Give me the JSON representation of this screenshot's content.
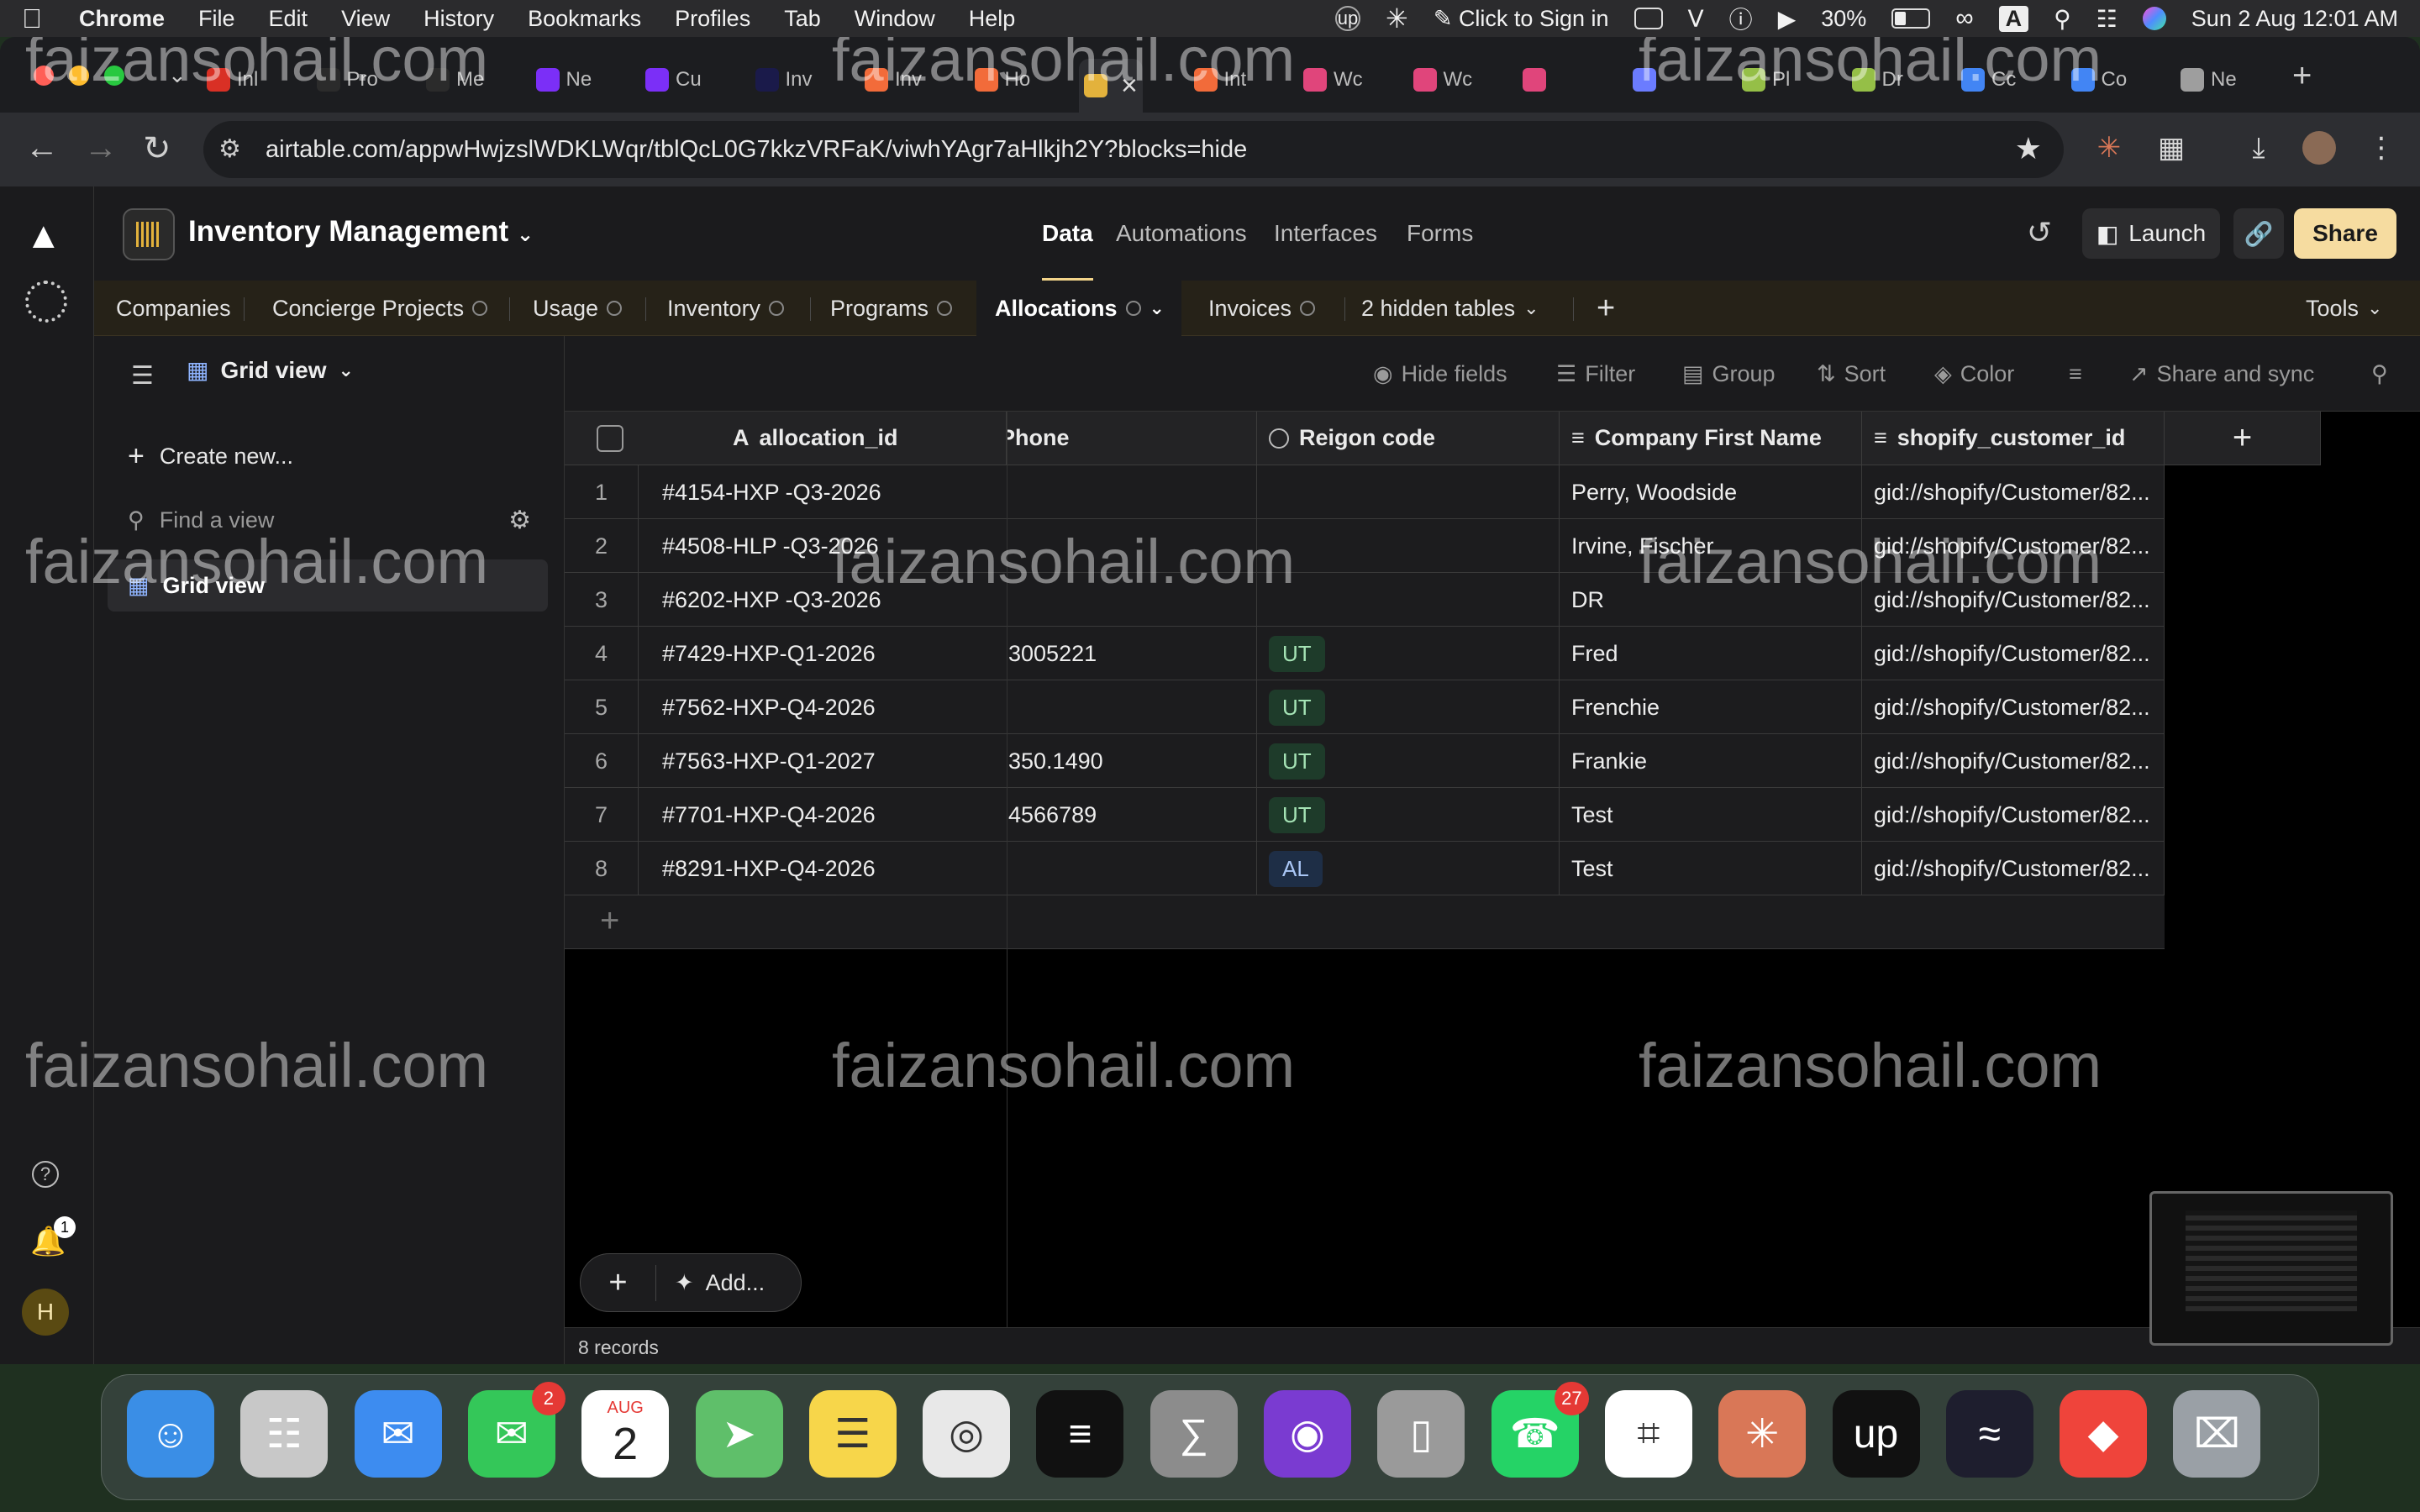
{
  "menubar": {
    "app": "Chrome",
    "items": [
      "File",
      "Edit",
      "View",
      "History",
      "Bookmarks",
      "Profiles",
      "Tab",
      "Window",
      "Help"
    ],
    "sign_in": "Click to Sign in",
    "battery": "30%",
    "battery_level": 0.3,
    "input_source": "A",
    "datetime": "Sun 2 Aug  12:01 AM"
  },
  "browser": {
    "tabs": [
      {
        "label": "Inl",
        "color": "#d93025"
      },
      {
        "label": "Pro",
        "color": "#2b2b2b"
      },
      {
        "label": "Me",
        "color": "#2b2b2b"
      },
      {
        "label": "Ne",
        "color": "#7b2ff7"
      },
      {
        "label": "Cu",
        "color": "#7b2ff7"
      },
      {
        "label": "Inv",
        "color": "#1a1a4a"
      },
      {
        "label": "Inv",
        "color": "#f26b3a"
      },
      {
        "label": "Ho",
        "color": "#f26b3a"
      },
      {
        "label": "",
        "color": "#e3b23c"
      },
      {
        "label": "Int",
        "color": "#f26b3a"
      },
      {
        "label": "Wc",
        "color": "#e0457b"
      },
      {
        "label": "Wc",
        "color": "#e0457b"
      },
      {
        "label": "",
        "color": "#e0457b"
      },
      {
        "label": "",
        "color": "#6b7cff"
      },
      {
        "label": "Pl",
        "color": "#95bf47"
      },
      {
        "label": "Dr",
        "color": "#95bf47"
      },
      {
        "label": "Cc",
        "color": "#4285f4"
      },
      {
        "label": "Co",
        "color": "#4285f4"
      },
      {
        "label": "Ne",
        "color": "#9e9e9e"
      }
    ],
    "url": "airtable.com/appwHwjzslWDKLWqr/tblQcL0G7kkzVRFaK/viwhYAgr7aHlkjh2Y?blocks=hide"
  },
  "airtable": {
    "base_name": "Inventory Management",
    "nav": [
      "Data",
      "Automations",
      "Interfaces",
      "Forms"
    ],
    "launch": "Launch",
    "share": "Share",
    "tables": [
      "Companies",
      "Concierge Projects",
      "Usage",
      "Inventory",
      "Programs",
      "Allocations",
      "Invoices"
    ],
    "hidden_tables": "2 hidden tables",
    "tools": "Tools",
    "view_name": "Grid view",
    "sidebar": {
      "create_new": "Create new...",
      "find_placeholder": "Find a view",
      "views": [
        "Grid view"
      ],
      "notifications_count": "1",
      "avatar_initial": "H"
    },
    "toolbar": [
      "Hide fields",
      "Filter",
      "Group",
      "Sort",
      "Color",
      "Share and sync"
    ],
    "columns": [
      "allocation_id",
      "Phone",
      "Reigon code",
      "Company First Name",
      "shopify_customer_id"
    ],
    "rows": [
      {
        "n": "1",
        "id": "#4154-HXP -Q3-2026",
        "phone": "",
        "region": "",
        "company": "Perry, Woodside",
        "shopify": "gid://shopify/Customer/82..."
      },
      {
        "n": "2",
        "id": "#4508-HLP -Q3-2026",
        "phone": "",
        "region": "",
        "company": "Irvine, Fischer",
        "shopify": "gid://shopify/Customer/82..."
      },
      {
        "n": "3",
        "id": "#6202-HXP -Q3-2026",
        "phone": "",
        "region": "",
        "company": "DR",
        "shopify": "gid://shopify/Customer/82..."
      },
      {
        "n": "4",
        "id": "#7429-HXP-Q1-2026",
        "phone": "3005221",
        "region": "UT",
        "company": "Fred",
        "shopify": "gid://shopify/Customer/82..."
      },
      {
        "n": "5",
        "id": "#7562-HXP-Q4-2026",
        "phone": "",
        "region": "UT",
        "company": "Frenchie",
        "shopify": "gid://shopify/Customer/82..."
      },
      {
        "n": "6",
        "id": "#7563-HXP-Q1-2027",
        "phone": "350.1490",
        "region": "UT",
        "company": "Frankie",
        "shopify": "gid://shopify/Customer/82..."
      },
      {
        "n": "7",
        "id": "#7701-HXP-Q4-2026",
        "phone": "4566789",
        "region": "UT",
        "company": "Test",
        "shopify": "gid://shopify/Customer/82..."
      },
      {
        "n": "8",
        "id": "#8291-HXP-Q4-2026",
        "phone": "",
        "region": "AL",
        "company": "Test",
        "shopify": "gid://shopify/Customer/82..."
      }
    ],
    "add_label": "Add...",
    "records_count": "8 records"
  },
  "watermark": "faizansohail.com",
  "dock": [
    {
      "name": "finder",
      "color": "#3a8ee6",
      "badge": ""
    },
    {
      "name": "launchpad",
      "color": "#c8c8c8",
      "badge": ""
    },
    {
      "name": "mail",
      "color": "#3d8cf0",
      "badge": ""
    },
    {
      "name": "messages",
      "color": "#34c759",
      "badge": "2"
    },
    {
      "name": "calendar",
      "color": "#ffffff",
      "badge": "",
      "month": "AUG",
      "day": "2"
    },
    {
      "name": "maps",
      "color": "#5fbf6a",
      "badge": ""
    },
    {
      "name": "notes",
      "color": "#f7d64a",
      "badge": ""
    },
    {
      "name": "chrome",
      "color": "#e8e8e8",
      "badge": ""
    },
    {
      "name": "spotify",
      "color": "#111111",
      "badge": ""
    },
    {
      "name": "calculator",
      "color": "#8c8c8c",
      "badge": ""
    },
    {
      "name": "firefox",
      "color": "#7a3bd1",
      "badge": ""
    },
    {
      "name": "iphone-mirroring",
      "color": "#9a9a9a",
      "badge": ""
    },
    {
      "name": "whatsapp",
      "color": "#25d366",
      "badge": "27"
    },
    {
      "name": "slack",
      "color": "#ffffff",
      "badge": ""
    },
    {
      "name": "claude",
      "color": "#d97757",
      "badge": ""
    },
    {
      "name": "upwork",
      "color": "#111111",
      "badge": ""
    },
    {
      "name": "flow",
      "color": "#1e1e2e",
      "badge": ""
    },
    {
      "name": "anydesk",
      "color": "#ef443b",
      "badge": ""
    },
    {
      "name": "trash",
      "color": "#9aa0a6",
      "badge": ""
    }
  ]
}
